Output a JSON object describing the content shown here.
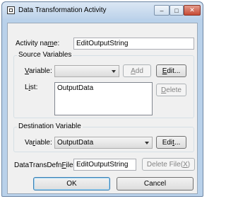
{
  "window": {
    "title": "Data Transformation Activity"
  },
  "activity": {
    "label_pre": "Activity na",
    "label_ul": "m",
    "label_post": "e:",
    "value": "EditOutputString"
  },
  "source": {
    "legend": "Source Variables",
    "variable_label_ul": "V",
    "variable_label_post": "ariable:",
    "variable_value": "",
    "add_button_ul": "A",
    "add_button_post": "dd",
    "edit_button_ul": "E",
    "edit_button_post": "dit...",
    "list_label_pre": "L",
    "list_label_ul": "i",
    "list_label_post": "st:",
    "list_items": [
      "OutputData"
    ],
    "delete_button_ul": "D",
    "delete_button_post": "elete"
  },
  "destination": {
    "legend": "Destination Variable",
    "variable_label_pre": "Va",
    "variable_label_ul": "r",
    "variable_label_post": "iable:",
    "variable_value": "OutputData",
    "edit_button_pre": "Edi",
    "edit_button_ul": "t",
    "edit_button_post": "..."
  },
  "defn_file": {
    "label_pre": "DataTransDefn",
    "label_ul": "F",
    "label_post": "ile:",
    "value": "EditOutputString",
    "delete_button_pre": "Delete File(",
    "delete_button_ul": "X",
    "delete_button_post": ")"
  },
  "footer": {
    "ok_label": "OK",
    "cancel_label": "Cancel"
  }
}
